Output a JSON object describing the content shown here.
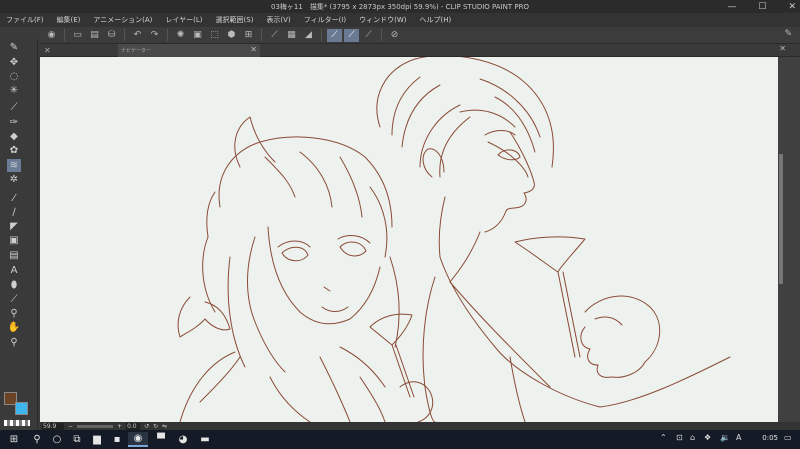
{
  "window": {
    "title": "03梅ヶ11　描集* (3795 x 2873px 350dpi 59.9%)  - CLIP STUDIO PAINT PRO"
  },
  "menu": [
    "ファイル(F)",
    "編集(E)",
    "アニメーション(A)",
    "レイヤー(L)",
    "選択範囲(S)",
    "表示(V)",
    "フィルター(I)",
    "ウィンドウ(W)",
    "ヘルプ(H)"
  ],
  "tabs": {
    "navigator_label": "ナビゲーター"
  },
  "status": {
    "zoom": "59.9",
    "angle": "0.0"
  },
  "taskbar": {
    "clock": "0:05"
  },
  "colors": {
    "main": "#6b4427",
    "sub": "#3fb5ee",
    "canvas": "#eef2ef",
    "lineart": "#8a4a36"
  },
  "icons": {
    "window": [
      "minimize-icon",
      "maximize-icon",
      "close-icon"
    ],
    "tools": [
      "pen-icon",
      "move-icon",
      "lasso-icon",
      "magic-wand-icon",
      "eyedropper-icon",
      "pen-tool-icon",
      "eraser-icon",
      "blend-icon",
      "brush-icon",
      "decoration-icon",
      "pencil-icon",
      "ruler-icon",
      "gradient-icon",
      "frame-icon",
      "text-icon",
      "fill-icon",
      "correct-line-icon",
      "balloon-icon",
      "hand-icon",
      "zoom-icon"
    ]
  }
}
